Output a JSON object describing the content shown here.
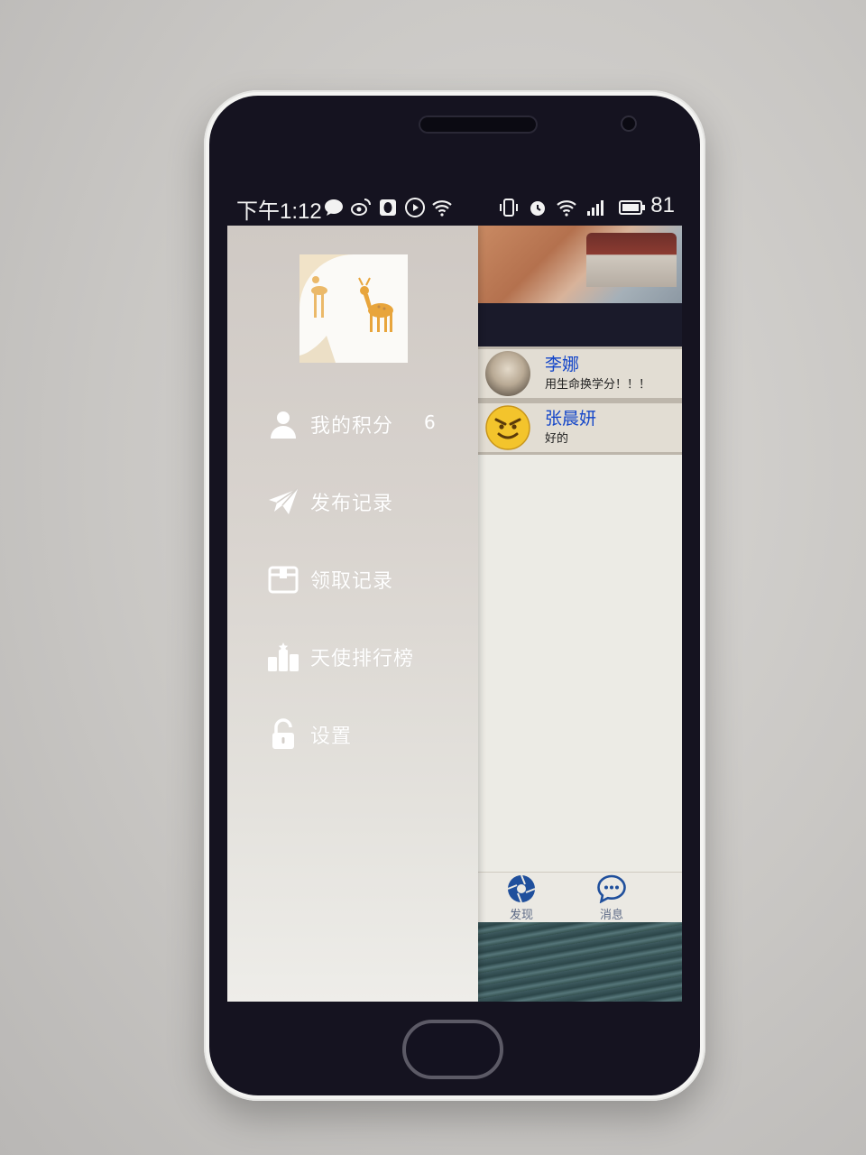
{
  "status_bar": {
    "time": "下午1:12",
    "battery": "81"
  },
  "drawer": {
    "menu": [
      {
        "label": "我的积分",
        "value": "6",
        "icon": "user-icon"
      },
      {
        "label": "发布记录",
        "icon": "send-icon"
      },
      {
        "label": "领取记录",
        "icon": "box-icon"
      },
      {
        "label": "天使排行榜",
        "icon": "ranking-icon"
      },
      {
        "label": "设置",
        "icon": "lock-icon"
      }
    ]
  },
  "messages": [
    {
      "name": "李娜",
      "text": "用生命换学分！！！"
    },
    {
      "name": "张晨妍",
      "text": "好的"
    }
  ],
  "tabs": [
    {
      "label": "发现",
      "icon": "aperture-icon"
    },
    {
      "label": "消息",
      "icon": "chat-bubble-icon"
    }
  ],
  "colors": {
    "drawer_text": "#ffffff",
    "message_name": "#1446c9",
    "tab_icon": "#1f4f9c"
  }
}
